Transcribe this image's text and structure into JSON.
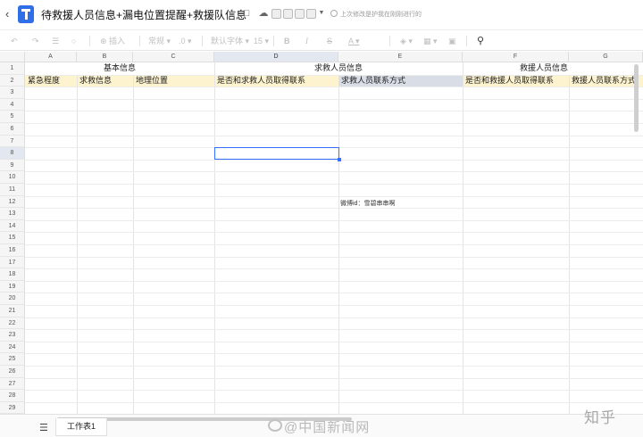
{
  "titlebar": {
    "title": "待救援人员信息+漏电位置提醒+救援队信息",
    "saved_text": "上次修改是护我在刚刚进行的",
    "icons": [
      "back-icon",
      "star-icon",
      "page-icon",
      "cloud-icon",
      "chevron-down-icon"
    ]
  },
  "toolbar": {
    "insert": "插入",
    "format": "常规",
    "font": "默认字体",
    "font_size": "15",
    "icons": [
      "undo-icon",
      "redo-icon",
      "format-painter-icon",
      "clear-format-icon",
      "insert-icon",
      "bold-icon",
      "italic-icon",
      "strikethrough-icon",
      "font-color-icon",
      "fill-color-icon",
      "border-icon",
      "merge-icon",
      "search-icon"
    ]
  },
  "sheet": {
    "columns": [
      "A",
      "B",
      "C",
      "D",
      "E",
      "F",
      "G"
    ],
    "selected_column": "D",
    "rows": [
      "1",
      "2",
      "3",
      "4",
      "5",
      "6",
      "7",
      "8",
      "9",
      "10",
      "11",
      "12",
      "13",
      "14",
      "15",
      "16",
      "17",
      "18",
      "19",
      "20",
      "21",
      "22",
      "23",
      "24",
      "25",
      "26",
      "27",
      "28",
      "29"
    ],
    "selected_row": "8",
    "groups": {
      "basic": "基本信息",
      "seeker": "求救人员信息",
      "rescuer": "救援人员信息"
    },
    "headers": {
      "a": "紧急程度",
      "b": "求救信息",
      "c": "地理位置",
      "d": "是否和求救人员取得联系",
      "e": "求救人员联系方式",
      "f": "是否和救援人员取得联系",
      "g": "救援人员联系方式"
    },
    "note": "微博id：雪碧串串啊"
  },
  "bottom": {
    "sheet_tab": "工作表1",
    "watermark": "@中国新闻网",
    "site_watermark": "知乎"
  },
  "colors": {
    "accent": "#3370ff",
    "header_yellow": "#fdf3cf",
    "header_blue": "#d9dde6"
  }
}
